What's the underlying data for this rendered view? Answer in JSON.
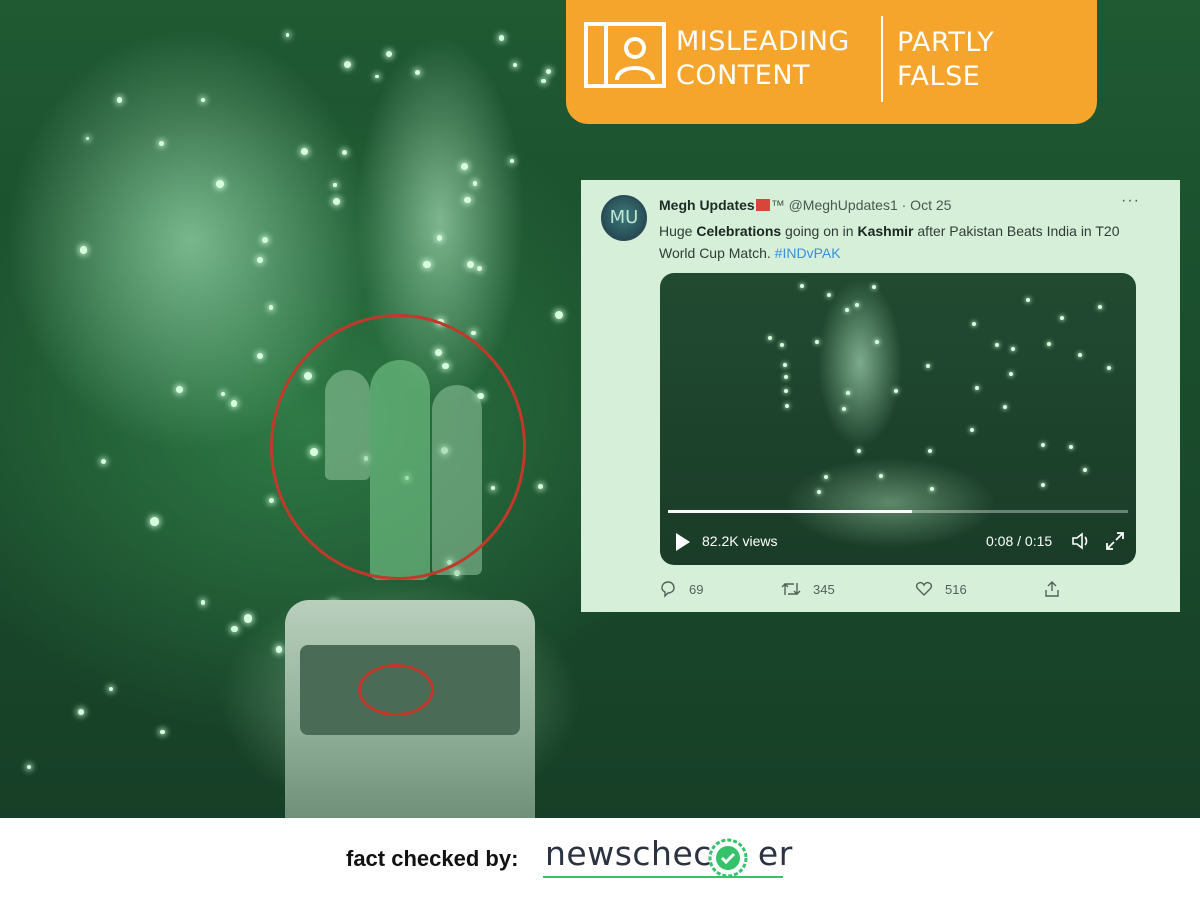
{
  "badge": {
    "line1": "MISLEADING",
    "line2": "CONTENT",
    "verdict1": "PARTLY",
    "verdict2": "FALSE",
    "color": "#f5a42c"
  },
  "tweet": {
    "avatar_text": "MU",
    "name": "Megh Updates",
    "name_suffix": "™",
    "handle_date": "@MeghUpdates1 · Oct 25",
    "more": "···",
    "text_parts": {
      "p1": "Huge ",
      "b1": "Celebrations",
      "p2": " going on in ",
      "b2": "Kashmir",
      "p3": " after Pakistan Beats India in T20 World Cup Match. ",
      "hashtag": "#INDvPAK"
    },
    "video": {
      "views": "82.2K views",
      "time": "0:08 / 0:15",
      "progress": 0.53
    },
    "actions": {
      "replies": "69",
      "retweets": "345",
      "likes": "516"
    },
    "hashtag_color": "#3b8fd9"
  },
  "footer": {
    "label": "fact checked by:",
    "brand_left": "newschec",
    "brand_right": "er",
    "brand_color": "#36c26a"
  }
}
